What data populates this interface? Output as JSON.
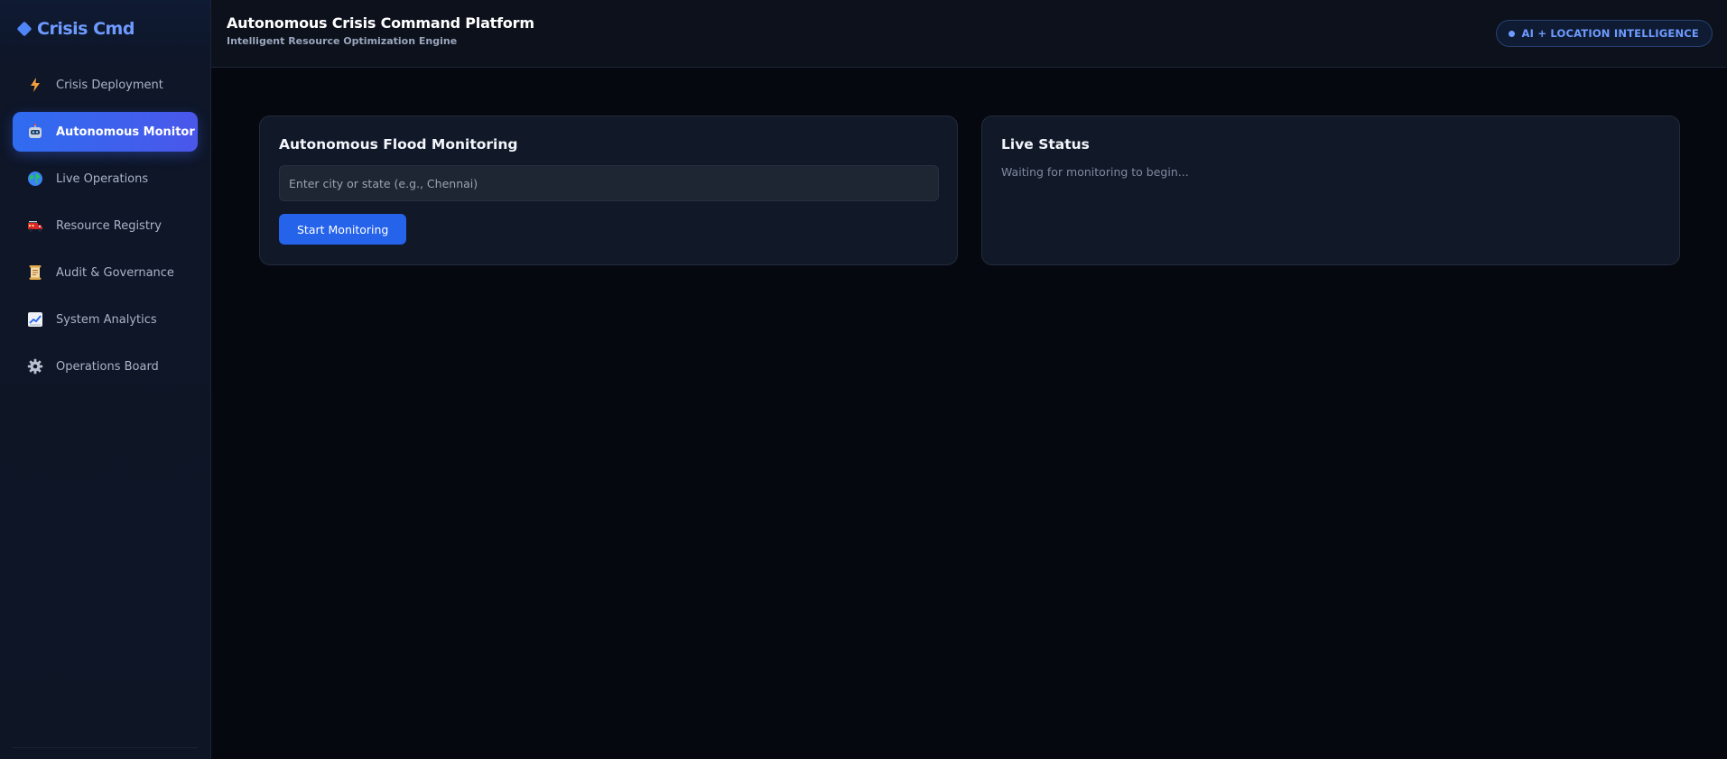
{
  "sidebar": {
    "brand": "Crisis Cmd",
    "items": [
      {
        "label": "Crisis Deployment",
        "icon": "lightning-icon",
        "active": false
      },
      {
        "label": "Autonomous Monitor",
        "icon": "robot-icon",
        "active": true
      },
      {
        "label": "Live Operations",
        "icon": "globe-icon",
        "active": false
      },
      {
        "label": "Resource Registry",
        "icon": "fire-truck-icon",
        "active": false
      },
      {
        "label": "Audit & Governance",
        "icon": "scroll-icon",
        "active": false
      },
      {
        "label": "System Analytics",
        "icon": "chart-increasing-icon",
        "active": false
      },
      {
        "label": "Operations Board",
        "icon": "gear-icon",
        "active": false
      }
    ]
  },
  "header": {
    "title": "Autonomous Crisis Command Platform",
    "subtitle": "Intelligent Resource Optimization Engine",
    "badge": "AI + LOCATION INTELLIGENCE"
  },
  "monitor_card": {
    "title": "Autonomous Flood Monitoring",
    "input_placeholder": "Enter city or state (e.g., Chennai)",
    "input_value": "",
    "button_label": "Start Monitoring"
  },
  "status_card": {
    "title": "Live Status",
    "message": "Waiting for monitoring to begin..."
  },
  "colors": {
    "accent": "#2563eb",
    "brand": "#6e9bff",
    "background": "#05080f",
    "card": "#111827"
  }
}
